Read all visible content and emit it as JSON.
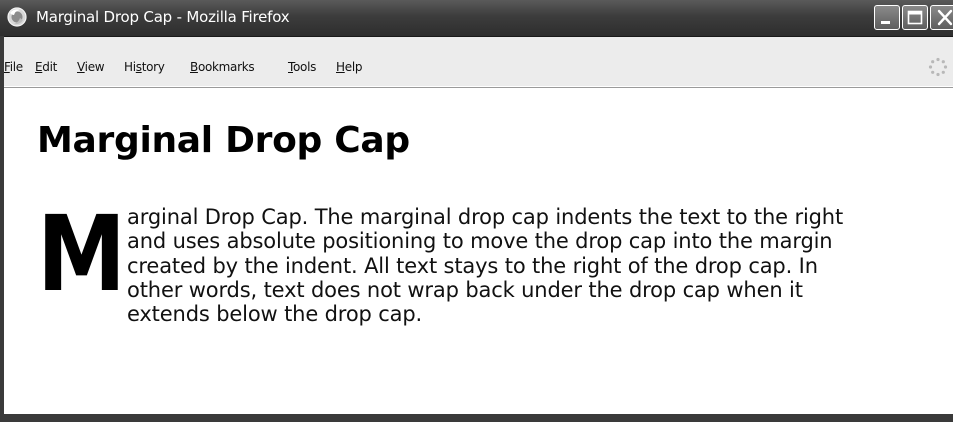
{
  "window": {
    "title": "Marginal Drop Cap - Mozilla Firefox",
    "controls": {
      "minimize_icon": "minimize-icon",
      "maximize_icon": "maximize-icon",
      "close_icon": "close-icon"
    }
  },
  "menu": {
    "items": [
      {
        "accel": "F",
        "rest": "ile"
      },
      {
        "accel": "E",
        "rest": "dit"
      },
      {
        "accel": "V",
        "rest": "iew"
      },
      {
        "pre": "Hi",
        "accel": "s",
        "rest": "tory"
      },
      {
        "accel": "B",
        "rest": "ookmarks"
      },
      {
        "accel": "T",
        "rest": "ools"
      },
      {
        "accel": "H",
        "rest": "elp"
      }
    ]
  },
  "page": {
    "title": "Marginal Drop Cap",
    "drop_cap": "M",
    "paragraph_lines": [
      "arginal Drop Cap. The marginal drop cap indents the text to the right",
      "and uses absolute positioning to move the drop cap into the margin",
      "created by the indent. All text stays to the right of the drop cap. In",
      "other words, text does not wrap back under the drop cap when it",
      "extends below the drop cap."
    ]
  },
  "colors": {
    "titlebar": "#3c3c3c",
    "menubar": "#ececec",
    "content_bg": "#ffffff",
    "text": "#111111"
  }
}
